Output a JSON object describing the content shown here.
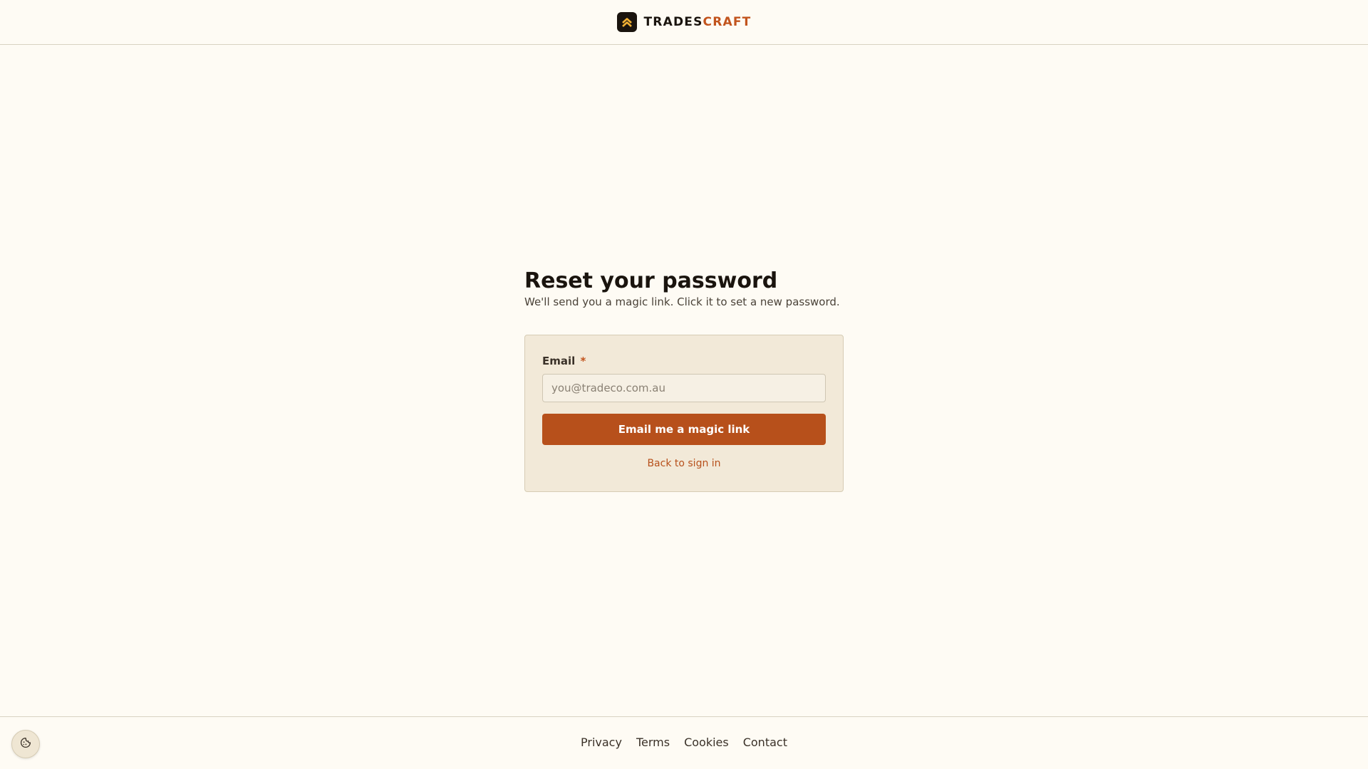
{
  "header": {
    "logo_icon": "chevron-up-double-icon",
    "brand_part1": "TRADES",
    "brand_part2": "CRAFT",
    "brand_color": "#c2541d"
  },
  "main": {
    "title": "Reset your password",
    "subtitle": "We'll send you a magic link. Click it to set a new password."
  },
  "form": {
    "email_label": "Email",
    "required_marker": "*",
    "email_value": "",
    "email_placeholder": "you@tradeco.com.au",
    "submit_label": "Email me a magic link",
    "back_link": "Back to sign in",
    "accent_color": "#b7501b"
  },
  "footer": {
    "links": [
      "Privacy",
      "Terms",
      "Cookies",
      "Contact"
    ],
    "cookie_icon": "cookie-icon"
  }
}
